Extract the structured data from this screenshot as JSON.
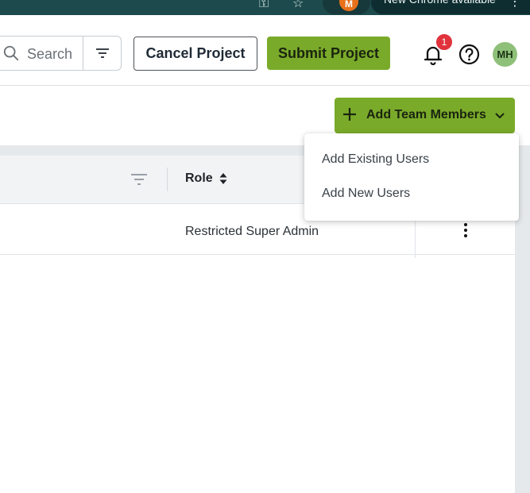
{
  "browser": {
    "profile_initial": "M",
    "update_text": "New Chrome available",
    "colors": {
      "bar": "#1d4a4d",
      "profile": "#e8711a"
    }
  },
  "header": {
    "search_placeholder": "Search",
    "cancel_label": "Cancel Project",
    "submit_label": "Submit Project",
    "notification_count": "1",
    "avatar_initials": "MH",
    "colors": {
      "primary": "#7aaa2a",
      "badge": "#e0333c",
      "avatar": "#8fc07a"
    }
  },
  "toolbar": {
    "add_team_label": "Add Team Members"
  },
  "dropdown": {
    "items": [
      {
        "label": "Add Existing Users"
      },
      {
        "label": "Add New Users"
      }
    ]
  },
  "table": {
    "columns": [
      {
        "label": "Role"
      }
    ],
    "rows": [
      {
        "role": "Restricted Super Admin"
      }
    ]
  }
}
